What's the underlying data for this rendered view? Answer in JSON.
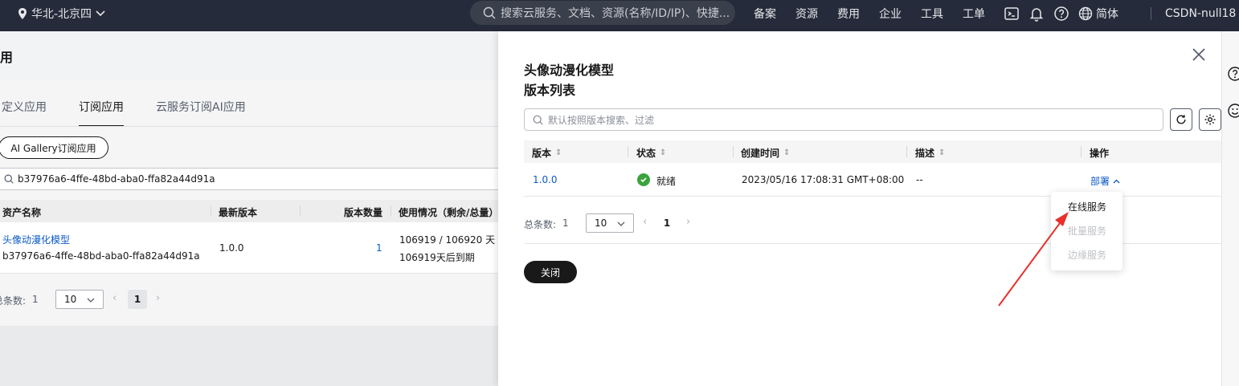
{
  "topbar": {
    "region": "华北-北京四",
    "search_placeholder": "搜索云服务、文档、资源(名称/ID/IP)、快捷...",
    "nav": [
      "备案",
      "资源",
      "费用",
      "企业",
      "工具",
      "工单"
    ],
    "lang": "简体",
    "account": "CSDN-null18"
  },
  "left": {
    "title": "用",
    "tabs": [
      "自定义应用",
      "订阅应用",
      "云服务订阅AI应用"
    ],
    "gallery_button": "AI Gallery订阅应用",
    "search_value": "b37976a6-4ffe-48bd-aba0-ffa82a44d91a",
    "table": {
      "headers": [
        "资产名称",
        "最新版本",
        "版本数量",
        "使用情况（剩余/总量）"
      ],
      "row": {
        "name": "头像动漫化模型",
        "id": "b37976a6-4ffe-48bd-aba0-ffa82a44d91a",
        "version": "1.0.0",
        "count": "1",
        "usage1": "106919 / 106920 天",
        "usage2": "106919天后到期"
      }
    },
    "pager": {
      "total_label": "总条数:",
      "total": "1",
      "page_size": "10",
      "current": "1"
    }
  },
  "drawer": {
    "title": "头像动漫化模型",
    "subtitle": "版本列表",
    "search_placeholder": "默认按照版本搜索、过滤",
    "headers": [
      "版本",
      "状态",
      "创建时间",
      "描述",
      "操作"
    ],
    "row": {
      "version": "1.0.0",
      "status": "就绪",
      "created": "2023/05/16 17:08:31 GMT+08:00",
      "desc": "--",
      "action": "部署"
    },
    "pager": {
      "total_label": "总条数:",
      "total": "1",
      "page_size": "10",
      "current": "1"
    },
    "close_button": "关闭"
  },
  "dropdown": {
    "items": [
      "在线服务",
      "批量服务",
      "边缘服务"
    ]
  },
  "colors": {
    "topbar": "#252b3a",
    "link": "#0a59c7",
    "success": "#3ba33e",
    "annotation_arrow": "#e8302c"
  }
}
